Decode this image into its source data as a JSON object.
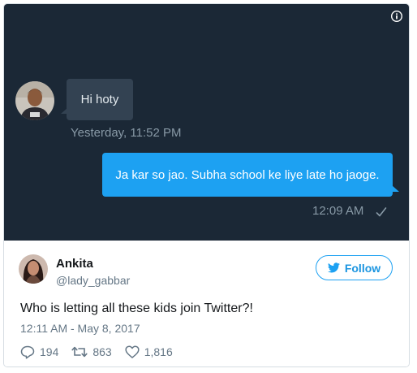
{
  "dm": {
    "incoming_message": "Hi hoty",
    "incoming_time": "Yesterday, 11:52 PM",
    "outgoing_message": "Ja kar so jao. Subha school ke liye late ho jaoge.",
    "outgoing_time": "12:09 AM",
    "icons": [
      "info-icon",
      "check-icon",
      "avatar"
    ]
  },
  "tweet": {
    "name": "Ankita",
    "handle": "@lady_gabbar",
    "follow_label": "Follow",
    "text": "Who is letting all these kids join Twitter?!",
    "timestamp": "12:11 AM - May 8, 2017",
    "replies": "194",
    "retweets": "863",
    "likes": "1,816"
  },
  "colors": {
    "dm_background": "#1b2836",
    "incoming_bubble": "#334252",
    "outgoing_bubble": "#1da1f2",
    "twitter_blue": "#1da1f2",
    "secondary_text": "#657786"
  }
}
